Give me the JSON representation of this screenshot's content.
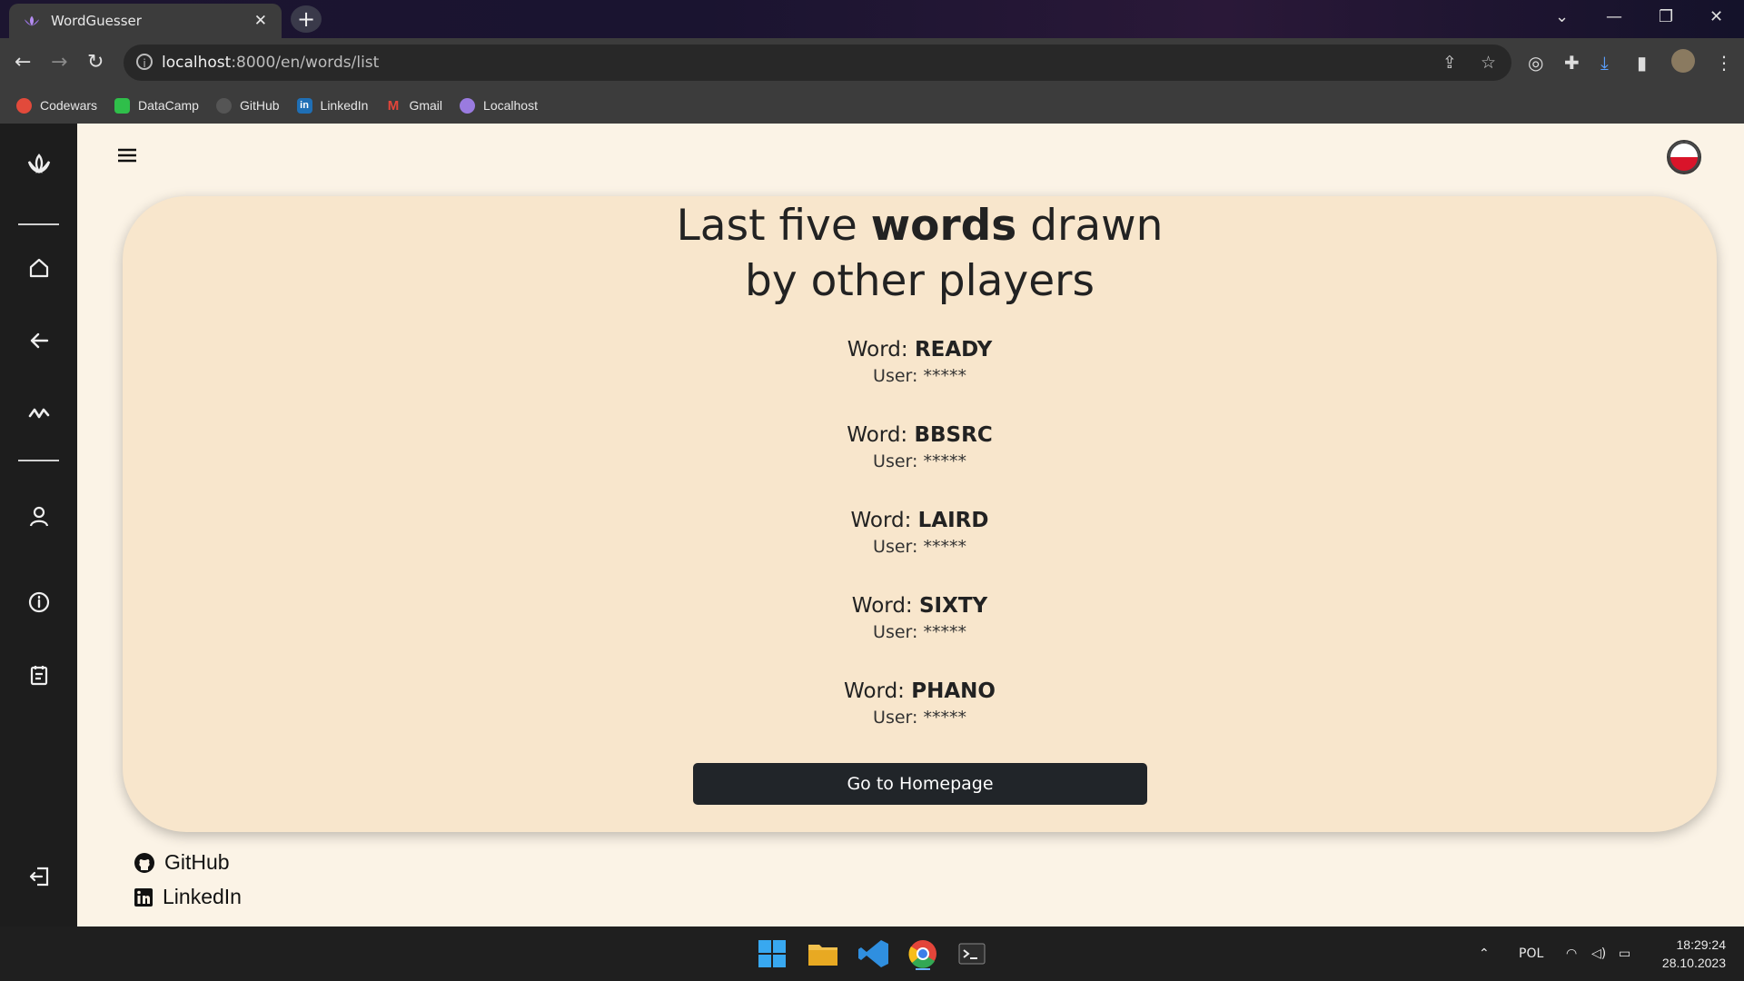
{
  "browser": {
    "tab_title": "WordGuesser",
    "tab_close": "✕",
    "new_tab": "+",
    "url_host": "localhost",
    "url_rest": ":8000/en/words/list",
    "bookmarks": [
      {
        "label": "Codewars",
        "color": "#e24a3b"
      },
      {
        "label": "DataCamp",
        "color": "#2fbf4a"
      },
      {
        "label": "GitHub",
        "color": "#555555"
      },
      {
        "label": "LinkedIn",
        "color": "#1f6fb5"
      },
      {
        "label": "Gmail",
        "color": "#e4453a"
      },
      {
        "label": "Localhost",
        "color": "#9a7be0"
      }
    ]
  },
  "sidebar": {
    "items": [
      {
        "icon": "lotus-logo-icon"
      },
      {
        "icon": "home-icon"
      },
      {
        "icon": "arrow-left-icon"
      },
      {
        "icon": "activity-icon"
      },
      {
        "icon": "user-icon"
      },
      {
        "icon": "info-icon"
      },
      {
        "icon": "clipboard-icon"
      },
      {
        "icon": "logout-icon"
      }
    ]
  },
  "main": {
    "heading_pre": "Last five ",
    "heading_bold": "words",
    "heading_post": " drawn",
    "heading_line2": "by other players",
    "word_prefix": "Word: ",
    "user_label": "User: *****",
    "entries": [
      {
        "word": "READY"
      },
      {
        "word": "BBSRC"
      },
      {
        "word": "LAIRD"
      },
      {
        "word": "SIXTY"
      },
      {
        "word": "PHANO"
      }
    ],
    "home_button": "Go to Homepage",
    "language_flag": "Polish flag"
  },
  "footer": {
    "github": "GitHub",
    "linkedin": "LinkedIn"
  },
  "taskbar": {
    "lang": "POL",
    "time": "18:29:24",
    "date": "28.10.2023"
  }
}
